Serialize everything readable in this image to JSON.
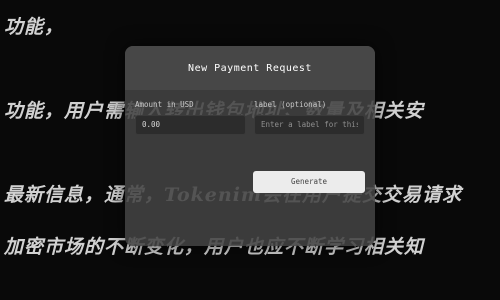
{
  "background_text": {
    "line1": "功能，",
    "line2": "功能，用户需输入转出钱包地址、数量及相关安",
    "line3": "最新信息，通常，Tokenim会在用户提交交易请求",
    "line4": "加密市场的不断变化，用户也应不断学习相关知"
  },
  "dialog": {
    "title": "New Payment Request",
    "amount": {
      "label": "Amount in USD",
      "value": "0.00"
    },
    "label_field": {
      "label": "label (optional)",
      "placeholder": "Enter a label for this"
    },
    "generate_button": "Generate"
  }
}
